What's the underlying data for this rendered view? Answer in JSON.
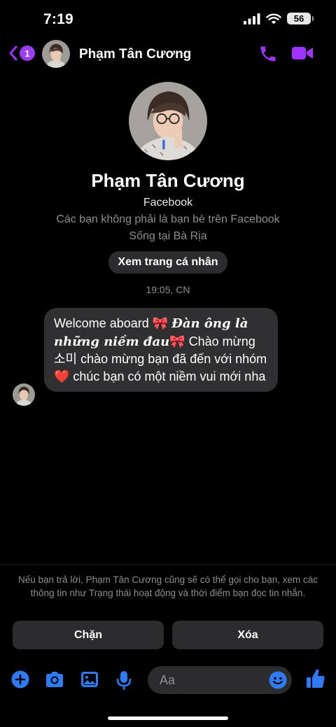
{
  "status_bar": {
    "time": "7:19",
    "battery": "56"
  },
  "header": {
    "back_badge_count": "1",
    "contact_name": "Phạm Tân Cương"
  },
  "profile": {
    "name": "Phạm Tân Cương",
    "source": "Facebook",
    "relationship": "Các bạn không phải là bạn bè trên Facebook",
    "location": "Sống tại Bà Rịa",
    "view_profile_label": "Xem trang cá nhân"
  },
  "conversation": {
    "timestamp": "19:05, CN",
    "message": {
      "part1": "Welcome aboard 🎀 ",
      "fancy": "Đàn ông là những niềm đau",
      "part2": "🎀 Chào mừng 소미 chào mừng bạn đã đến với nhóm ❤️ chúc bạn có một niềm vui mới nha"
    }
  },
  "footer": {
    "notice": "Nếu bạn trả lời, Phạm Tân Cương cũng sẽ có thể gọi cho bạn, xem các thông tin như Trạng thái hoạt động và thời điểm bạn đọc tin nhắn.",
    "block_label": "Chặn",
    "delete_label": "Xóa"
  },
  "composer": {
    "placeholder": "Aa"
  },
  "icons": {
    "accent": "#a033ff",
    "composer_blue": "#2f7bf5",
    "status": [
      "signal-icon",
      "wifi-icon",
      "battery-icon"
    ],
    "header": [
      "back-icon",
      "phone-icon",
      "video-icon"
    ],
    "composer": [
      "plus-icon",
      "camera-icon",
      "image-icon",
      "mic-icon",
      "emoji-icon",
      "like-icon"
    ]
  }
}
